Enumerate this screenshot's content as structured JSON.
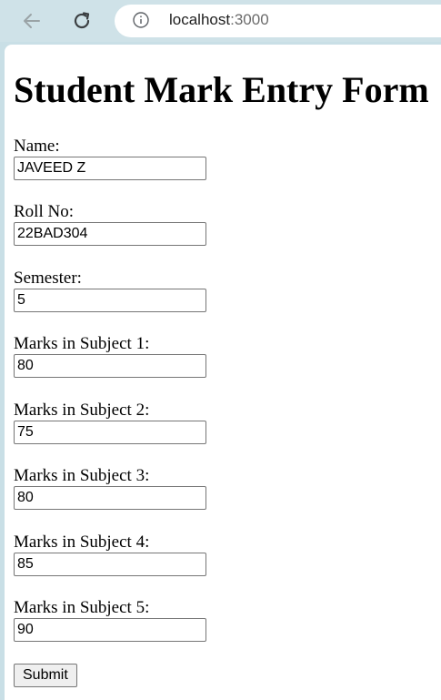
{
  "browser": {
    "url_host": "localhost",
    "url_port": ":3000"
  },
  "page": {
    "title": "Student Mark Entry Form",
    "fields": [
      {
        "label": "Name:",
        "value": "JAVEED Z"
      },
      {
        "label": "Roll No:",
        "value": "22BAD304"
      },
      {
        "label": "Semester:",
        "value": "5"
      },
      {
        "label": "Marks in Subject 1:",
        "value": "80"
      },
      {
        "label": "Marks in Subject 2:",
        "value": "75"
      },
      {
        "label": "Marks in Subject 3:",
        "value": "80"
      },
      {
        "label": "Marks in Subject 4:",
        "value": "85"
      },
      {
        "label": "Marks in Subject 5:",
        "value": "90"
      }
    ],
    "submit_label": "Submit"
  },
  "colors": {
    "chrome_background": "#cfe2e8",
    "page_background": "#ffffff"
  }
}
